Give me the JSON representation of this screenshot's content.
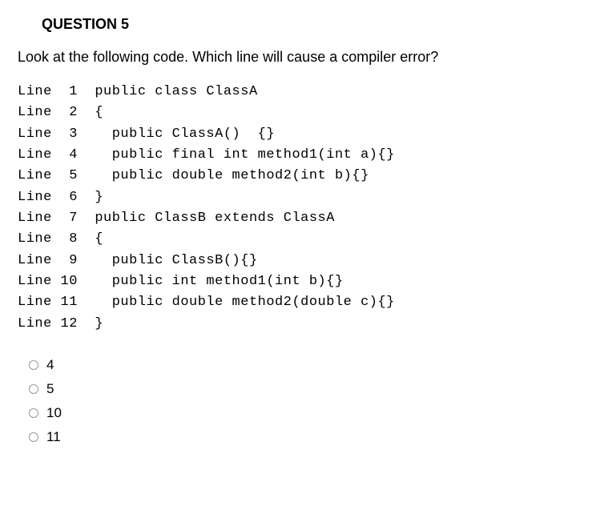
{
  "title": "QUESTION 5",
  "prompt": "Look at the following code. Which line will cause a compiler error?",
  "code": "Line  1  public class ClassA\nLine  2  {\nLine  3    public ClassA()  {}\nLine  4    public final int method1(int a){}\nLine  5    public double method2(int b){}\nLine  6  }\nLine  7  public ClassB extends ClassA\nLine  8  {\nLine  9    public ClassB(){}\nLine 10    public int method1(int b){}\nLine 11    public double method2(double c){}\nLine 12  }",
  "options": [
    {
      "label": "4"
    },
    {
      "label": "5"
    },
    {
      "label": "10"
    },
    {
      "label": "11"
    }
  ]
}
